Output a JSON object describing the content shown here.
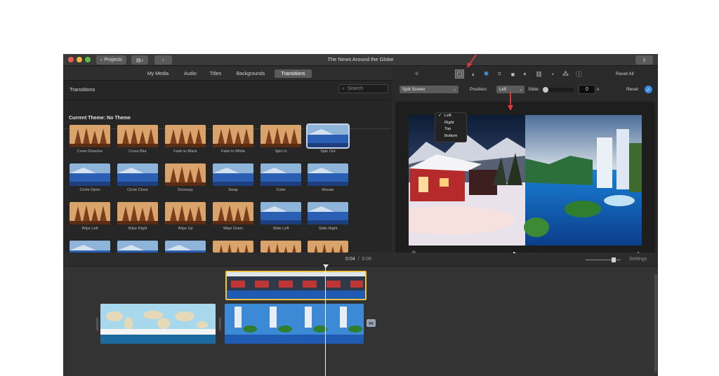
{
  "window": {
    "title": "The News Around the Globe",
    "projects_label": "Projects"
  },
  "media_tabs": [
    {
      "label": "My Media",
      "active": false
    },
    {
      "label": "Audio",
      "active": false
    },
    {
      "label": "Titles",
      "active": false
    },
    {
      "label": "Backgrounds",
      "active": false
    },
    {
      "label": "Transitions",
      "active": true
    }
  ],
  "browser": {
    "section_title": "Transitions",
    "search_placeholder": "Search",
    "theme_label": "Current Theme: No Theme"
  },
  "transitions": [
    {
      "label": "Cross Dissolve",
      "icon": "tree-scene"
    },
    {
      "label": "Cross Blur",
      "icon": "tree-scene"
    },
    {
      "label": "Fade to Black",
      "icon": "tree-scene"
    },
    {
      "label": "Fade to White",
      "icon": "tree-scene"
    },
    {
      "label": "Spin In",
      "icon": "tree-scene"
    },
    {
      "label": "Spin Out",
      "icon": "sea-scene",
      "selected": true
    },
    {
      "label": "Circle Open",
      "icon": "sea-scene"
    },
    {
      "label": "Circle Close",
      "icon": "sea-scene"
    },
    {
      "label": "Doorway",
      "icon": "tree-scene"
    },
    {
      "label": "Swap",
      "icon": "sea-scene"
    },
    {
      "label": "Cube",
      "icon": "sea-scene"
    },
    {
      "label": "Mosaic",
      "icon": "sea-scene"
    },
    {
      "label": "Wipe Left",
      "icon": "tree-scene"
    },
    {
      "label": "Wipe Right",
      "icon": "tree-scene"
    },
    {
      "label": "Wipe Up",
      "icon": "tree-scene"
    },
    {
      "label": "Wipe Down",
      "icon": "tree-scene"
    },
    {
      "label": "Slide Left",
      "icon": "sea-scene"
    },
    {
      "label": "Slide Right",
      "icon": "sea-scene"
    }
  ],
  "adjust": {
    "reset_all_label": "Reset All",
    "style_value": "Split Screen",
    "position_label": "Position:",
    "position_value": "Left",
    "slide_label": "Slide:",
    "slide_value": "0",
    "slide_unit": "s",
    "reset_label": "Reset",
    "position_options": [
      "Left",
      "Right",
      "Top",
      "Bottom"
    ],
    "checked_option": "Left"
  },
  "timeline": {
    "current_time": "0:04",
    "separator": "/",
    "total_time": "0:06",
    "settings_label": "Settings",
    "zoom_fraction": 0.8
  },
  "colors": {
    "selection_yellow": "#f5c542",
    "red_arrow": "#e03a3a",
    "accent_blue": "#3b8ee8"
  }
}
